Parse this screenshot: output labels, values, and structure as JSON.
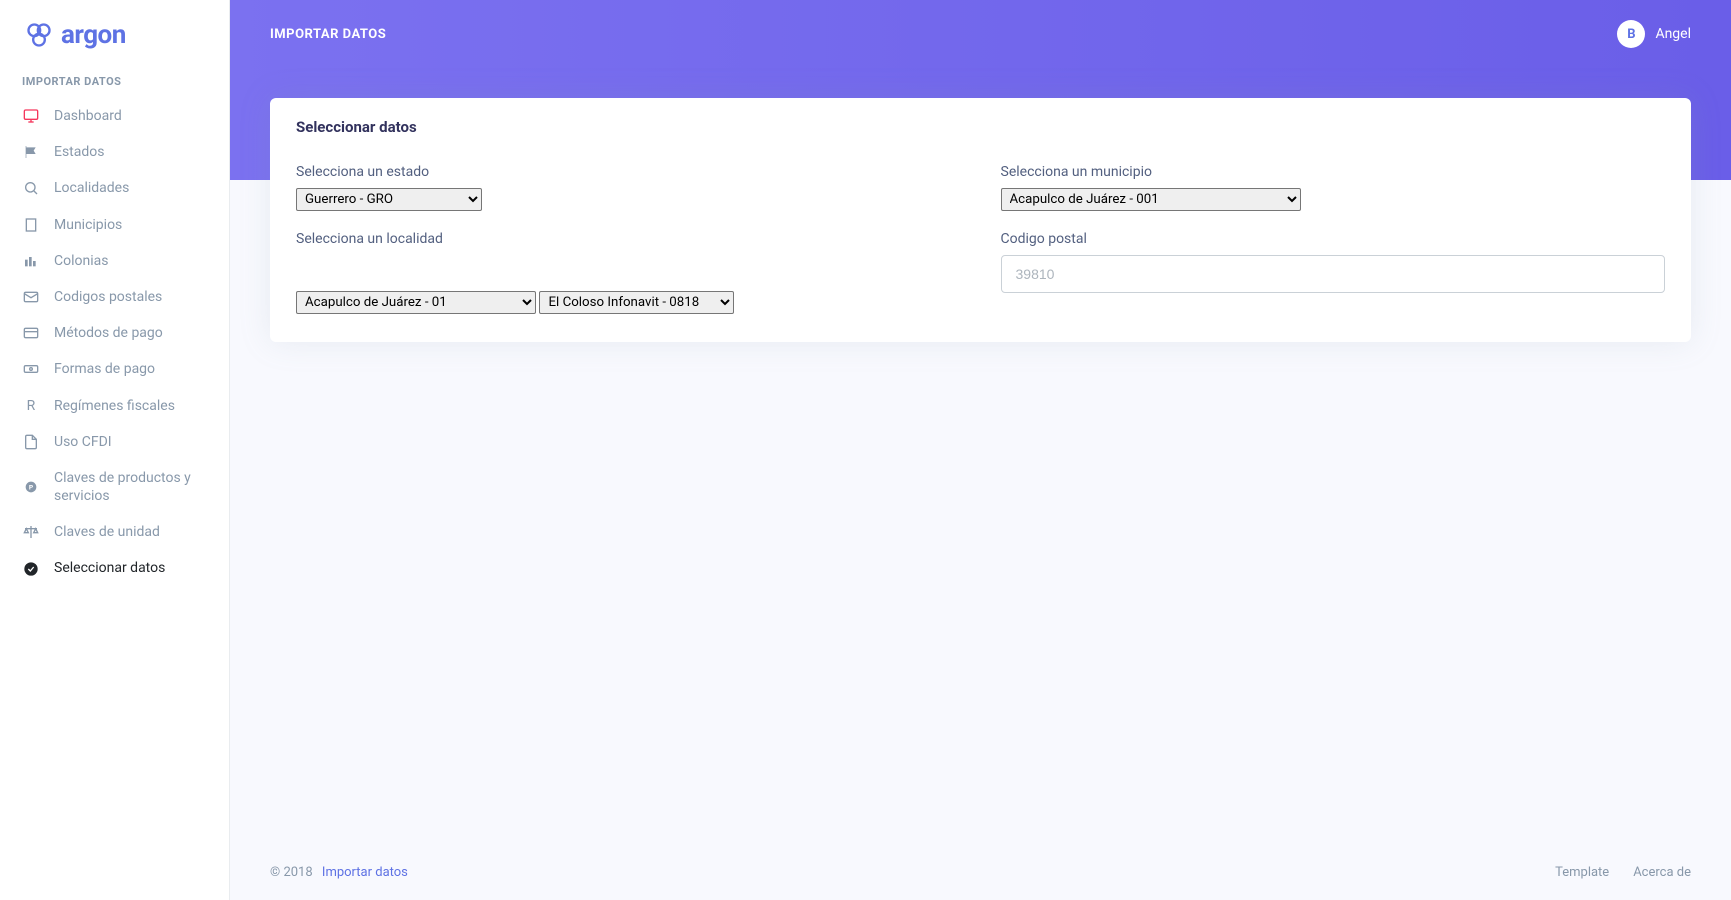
{
  "brand": {
    "name": "argon"
  },
  "sidebar": {
    "heading": "IMPORTAR DATOS",
    "items": [
      {
        "label": "Dashboard"
      },
      {
        "label": "Estados"
      },
      {
        "label": "Localidades"
      },
      {
        "label": "Municipios"
      },
      {
        "label": "Colonias"
      },
      {
        "label": "Codigos postales"
      },
      {
        "label": "Métodos de pago"
      },
      {
        "label": "Formas de pago"
      },
      {
        "label": "Regímenes fiscales"
      },
      {
        "label": "Uso CFDI"
      },
      {
        "label": "Claves de productos y servicios"
      },
      {
        "label": "Claves de unidad"
      },
      {
        "label": "Seleccionar datos"
      }
    ]
  },
  "header": {
    "title": "IMPORTAR DATOS",
    "user_badge": "B",
    "user_name": "Angel"
  },
  "card": {
    "title": "Seleccionar datos",
    "estado_label": "Selecciona un estado",
    "estado_value": "Guerrero - GRO",
    "municipio_label": "Selecciona un municipio",
    "municipio_value": "Acapulco de Juárez - 001",
    "localidad_label": "Selecciona un localidad",
    "localidad_value": "Acapulco de Juárez - 01",
    "cp_label": "Codigo postal",
    "cp_placeholder": "39810",
    "colonia_value": "El Coloso Infonavit - 0818"
  },
  "footer": {
    "copyright": "© 2018",
    "link_text": "Importar datos",
    "link_template": "Template",
    "link_acerca": "Acerca de"
  }
}
